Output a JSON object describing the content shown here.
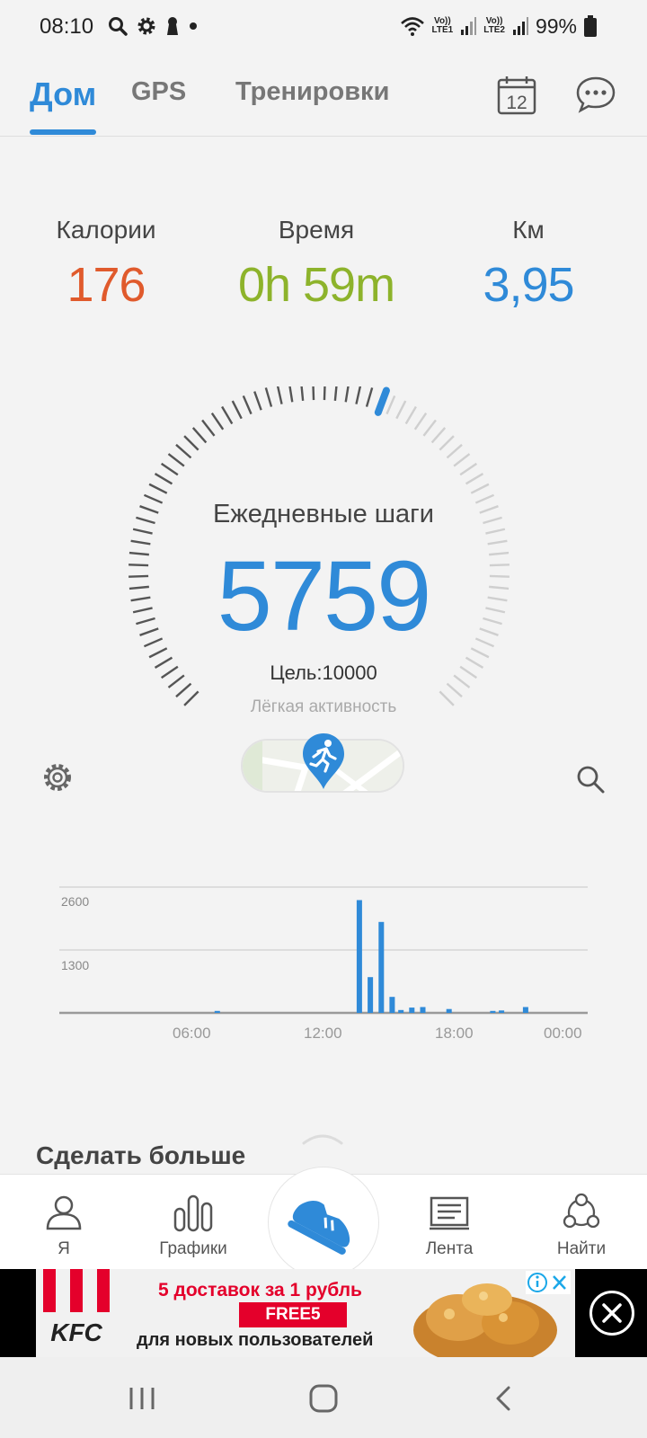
{
  "status_bar": {
    "time": "08:10",
    "battery": "99%",
    "sim1": "LTE1",
    "sim2": "LTE2",
    "volte": "Vo))"
  },
  "tabs": [
    {
      "label": "Дом",
      "active": true
    },
    {
      "label": "GPS",
      "active": false
    },
    {
      "label": "Тренировки",
      "active": false
    }
  ],
  "calendar_day": "12",
  "stats": [
    {
      "label": "Калории",
      "value": "176",
      "color": "#e05a2c"
    },
    {
      "label": "Время",
      "value": "0h 59m",
      "color": "#8db32b"
    },
    {
      "label": "Км",
      "value": "3,95",
      "color": "#2f8ad8"
    }
  ],
  "gauge": {
    "title": "Ежедневные шаги",
    "steps": "5759",
    "goal": "Цель:10000",
    "activity_level": "Лёгкая активность",
    "progress_fraction": 0.5759
  },
  "chart_data": {
    "type": "bar",
    "x": [
      "06:00",
      "12:00",
      "18:00",
      "00:00"
    ],
    "ylabels": [
      "2600",
      "1300"
    ],
    "ylim": [
      0,
      2600
    ],
    "hours_start": 0,
    "bars": [
      {
        "h": 7.1,
        "v": 40
      },
      {
        "h": 13.6,
        "v": 2330
      },
      {
        "h": 14.1,
        "v": 740
      },
      {
        "h": 14.6,
        "v": 1880
      },
      {
        "h": 15.1,
        "v": 330
      },
      {
        "h": 15.5,
        "v": 60
      },
      {
        "h": 16.0,
        "v": 110
      },
      {
        "h": 16.5,
        "v": 120
      },
      {
        "h": 17.7,
        "v": 80
      },
      {
        "h": 19.7,
        "v": 40
      },
      {
        "h": 20.1,
        "v": 50
      },
      {
        "h": 21.2,
        "v": 120
      }
    ]
  },
  "more_title": "Сделать больше",
  "bottom_nav": [
    {
      "label": "Я",
      "icon": "person-icon"
    },
    {
      "label": "Графики",
      "icon": "bar-chart-icon"
    },
    {
      "label": "",
      "icon": "running-shoe-icon"
    },
    {
      "label": "Лента",
      "icon": "feed-icon"
    },
    {
      "label": "Найти",
      "icon": "people-network-icon"
    }
  ],
  "ad": {
    "brand": "KFC",
    "line1": "5 доставок за 1 рубль",
    "code": "FREE5",
    "line2": "для новых пользователей"
  }
}
